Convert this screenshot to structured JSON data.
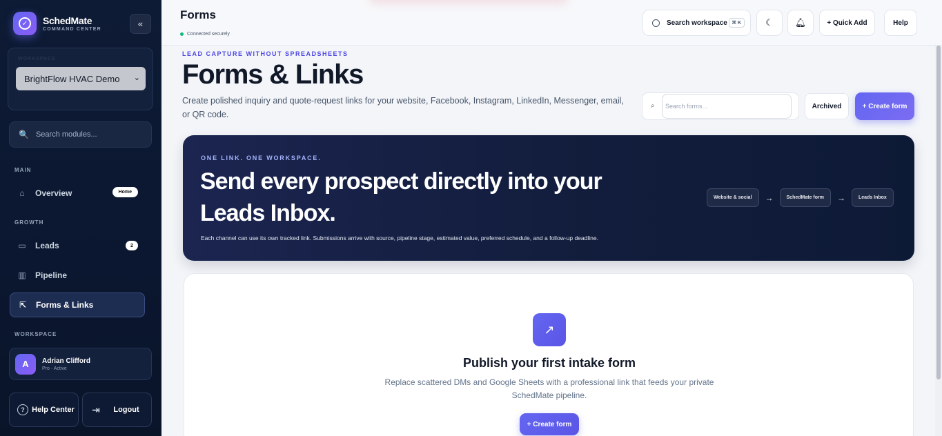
{
  "brand": {
    "name": "SchedMate",
    "subtitle": "COMMAND CENTER"
  },
  "sidebar": {
    "collapse_glyph": "«",
    "workspace_label": "WORKSPACE",
    "workspace_selected": "BrightFlow HVAC Demo",
    "module_search_placeholder": "Search modules...",
    "sections": {
      "main": "MAIN",
      "growth": "GROWTH",
      "workspace": "WORKSPACE"
    },
    "items": {
      "overview": {
        "label": "Overview",
        "badge": "Home"
      },
      "leads": {
        "label": "Leads",
        "badge": "2"
      },
      "pipeline": {
        "label": "Pipeline"
      },
      "forms": {
        "label": "Forms & Links"
      }
    },
    "user": {
      "initial": "A",
      "name": "Adrian Clifford",
      "status": "Pro · Active"
    },
    "help_label": "Help Center",
    "logout_label": "Logout"
  },
  "topbar": {
    "title": "Forms",
    "connection": "Connected securely",
    "search_label": "Search workspace",
    "search_shortcut": "⌘ K",
    "quick_add": "+ Quick Add",
    "help": "Help"
  },
  "main": {
    "eyebrow": "LEAD CAPTURE WITHOUT SPREADSHEETS",
    "title": "Forms & Links",
    "description": "Create polished inquiry and quote-request links for your website, Facebook, Instagram, LinkedIn, Messenger, email, or QR code.",
    "search_placeholder": "Search forms...",
    "archived": "Archived",
    "create": "+ Create form"
  },
  "hero": {
    "eyebrow": "ONE LINK. ONE WORKSPACE.",
    "title": "Send every prospect directly into your Leads Inbox.",
    "description": "Each channel can use its own tracked link. Submissions arrive with source, pipeline stage, estimated value, preferred schedule, and a follow-up deadline.",
    "flow": [
      "Website & social",
      "SchedMate form",
      "Leads Inbox"
    ]
  },
  "empty": {
    "title": "Publish your first intake form",
    "description": "Replace scattered DMs and Google Sheets with a professional link that feeds your private SchedMate pipeline.",
    "button": "+ Create form"
  },
  "colors": {
    "accent": "#6366f1",
    "sidebar_bg": "#0e1b35",
    "hero_bg": "#131d3d",
    "status_ok": "#10b981"
  },
  "icons": {
    "brand": "check-circle-icon",
    "overview": "home-icon",
    "leads": "inbox-icon",
    "pipeline": "kanban-icon",
    "forms": "share-icon",
    "search": "search-icon",
    "theme": "moon-icon",
    "notifications": "bell-icon",
    "help": "question-circle-icon",
    "logout": "logout-icon",
    "empty": "arrow-up-right-icon"
  }
}
